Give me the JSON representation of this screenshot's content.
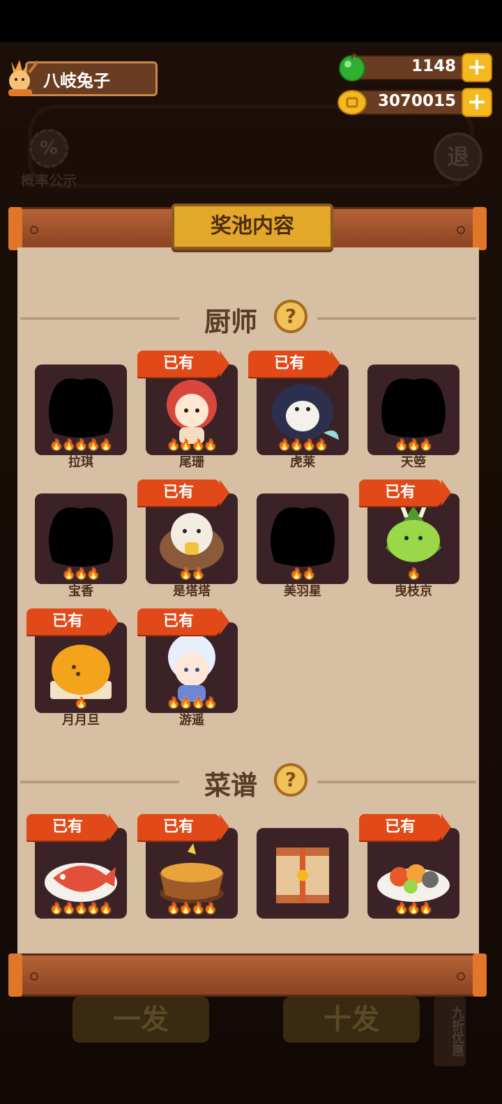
{
  "player": {
    "name": "八岐兔子"
  },
  "currencies": [
    {
      "id": "jade",
      "value": "1148",
      "icon": "green-orb-icon",
      "color": "#2fae2f"
    },
    {
      "id": "coin",
      "value": "3070015",
      "icon": "gold-coin-icon",
      "color": "#f3b91f"
    }
  ],
  "background": {
    "probability_label": "概率公示",
    "probability_icon": "%",
    "exit_label": "退",
    "single_draw": "一发",
    "ten_draw": "十发",
    "discount": "九折优惠"
  },
  "panel": {
    "title": "奖池内容",
    "owned_label": "已有",
    "sections": [
      {
        "name": "厨师",
        "help": "?",
        "items": [
          {
            "name": "拉琪",
            "stars": 5,
            "owned": false,
            "art": "silhouette"
          },
          {
            "name": "尾珊",
            "stars": 4,
            "owned": true,
            "art": "red-hair-girl"
          },
          {
            "name": "虎莱",
            "stars": 4,
            "owned": true,
            "art": "orca"
          },
          {
            "name": "天箜",
            "stars": 3,
            "owned": false,
            "art": "silhouette"
          },
          {
            "name": "宝香",
            "stars": 3,
            "owned": false,
            "art": "silhouette"
          },
          {
            "name": "是塔塔",
            "stars": 2,
            "owned": true,
            "art": "seal"
          },
          {
            "name": "美羽星",
            "stars": 2,
            "owned": false,
            "art": "silhouette"
          },
          {
            "name": "曳枝京",
            "stars": 1,
            "owned": true,
            "art": "zongzi"
          },
          {
            "name": "月月旦",
            "stars": 1,
            "owned": true,
            "art": "pudding"
          },
          {
            "name": "游遥",
            "stars": 4,
            "owned": true,
            "art": "cloud-boy"
          }
        ]
      },
      {
        "name": "菜谱",
        "help": "?",
        "items": [
          {
            "name": "",
            "stars": 5,
            "owned": true,
            "art": "fish-plate"
          },
          {
            "name": "",
            "stars": 4,
            "owned": true,
            "art": "clay-pot"
          },
          {
            "name": "",
            "stars": 0,
            "owned": false,
            "art": "scroll"
          },
          {
            "name": "",
            "stars": 3,
            "owned": true,
            "art": "seafood-plate"
          }
        ]
      }
    ]
  }
}
